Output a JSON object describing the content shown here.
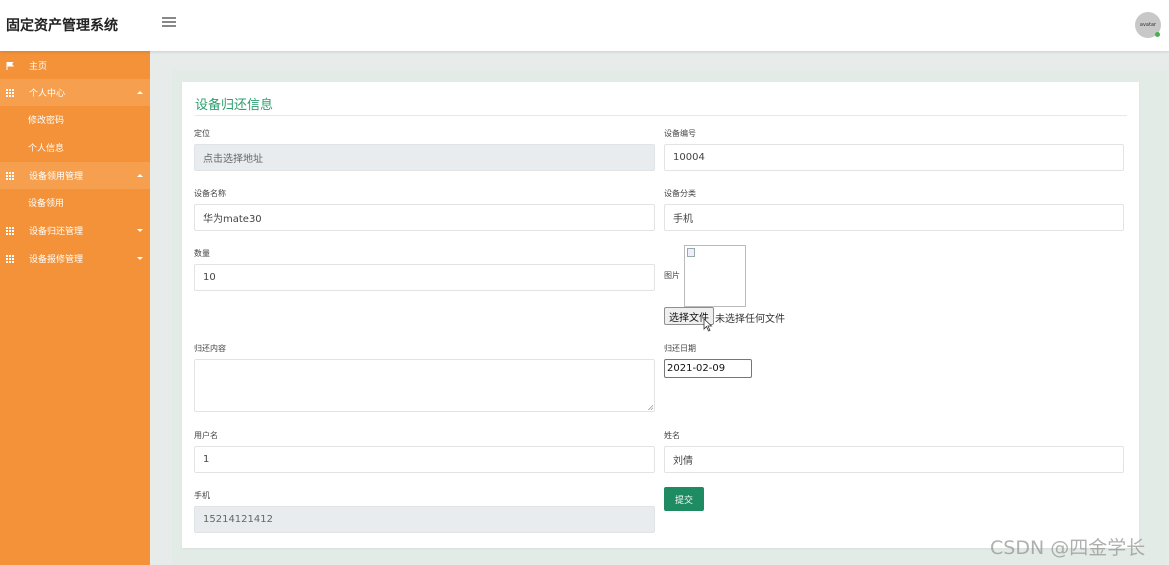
{
  "header": {
    "app_title": "固定资产管理系统",
    "avatar_text": "avatar"
  },
  "sidebar": {
    "items": [
      {
        "label": "主页",
        "icon": "flag-icon"
      },
      {
        "label": "个人中心",
        "icon": "grid-icon",
        "expanded": true
      },
      {
        "label": "修改密码"
      },
      {
        "label": "个人信息"
      },
      {
        "label": "设备领用管理",
        "icon": "grid-icon",
        "expanded": true
      },
      {
        "label": "设备领用"
      },
      {
        "label": "设备归还管理",
        "icon": "grid-icon",
        "expanded": false
      },
      {
        "label": "设备报修管理",
        "icon": "grid-icon",
        "expanded": false
      }
    ]
  },
  "form": {
    "title": "设备归还信息",
    "location": {
      "label": "定位",
      "placeholder": "点击选择地址"
    },
    "device_number": {
      "label": "设备编号",
      "value": "10004"
    },
    "device_name": {
      "label": "设备名称",
      "value": "华为mate30"
    },
    "device_category": {
      "label": "设备分类",
      "value": "手机"
    },
    "quantity": {
      "label": "数量",
      "value": "10"
    },
    "image": {
      "label": "图片",
      "file_button": "选择文件",
      "file_status": "未选择任何文件"
    },
    "return_content": {
      "label": "归还内容",
      "value": ""
    },
    "return_date": {
      "label": "归还日期",
      "value": "2021-02-09"
    },
    "username": {
      "label": "用户名",
      "value": "1"
    },
    "name": {
      "label": "姓名",
      "value": "刘倩"
    },
    "phone": {
      "label": "手机",
      "value": "15214121412"
    },
    "submit_label": "提交"
  },
  "watermark": "CSDN @四金学长",
  "colors": {
    "sidebar": "#f39238",
    "accent": "#2e9d6f",
    "submit": "#1e8b63"
  }
}
